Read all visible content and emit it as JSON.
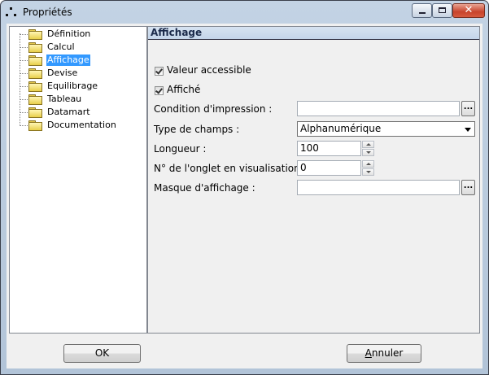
{
  "window": {
    "title": "Propriétés"
  },
  "controls": {
    "minimize_icon": "minimize-icon",
    "maximize_icon": "maximize-icon",
    "close_icon": "close-icon",
    "close_glyph": "✕"
  },
  "tree": {
    "items": [
      {
        "label": "Définition",
        "selected": false
      },
      {
        "label": "Calcul",
        "selected": false
      },
      {
        "label": "Affichage",
        "selected": true
      },
      {
        "label": "Devise",
        "selected": false
      },
      {
        "label": "Equilibrage",
        "selected": false
      },
      {
        "label": "Tableau",
        "selected": false
      },
      {
        "label": "Datamart",
        "selected": false
      },
      {
        "label": "Documentation",
        "selected": false
      }
    ]
  },
  "panel": {
    "title": "Affichage",
    "valeur_accessible": {
      "label": "Valeur accessible",
      "checked": true
    },
    "affiche": {
      "label": "Affiché",
      "checked": true
    },
    "condition": {
      "label": "Condition d'impression :",
      "value": "",
      "button": "..."
    },
    "type_champs": {
      "label": "Type de champs :",
      "value": "Alphanumérique"
    },
    "longueur": {
      "label": "Longueur :",
      "value": "100"
    },
    "onglet_rss": {
      "label": "N° de l'onglet en visualisation RSS :",
      "value": "0"
    },
    "masque": {
      "label": "Masque d'affichage :",
      "value": "",
      "button": "..."
    }
  },
  "footer": {
    "ok_label": "OK",
    "cancel_accel": "A",
    "cancel_rest": "nnuler"
  }
}
